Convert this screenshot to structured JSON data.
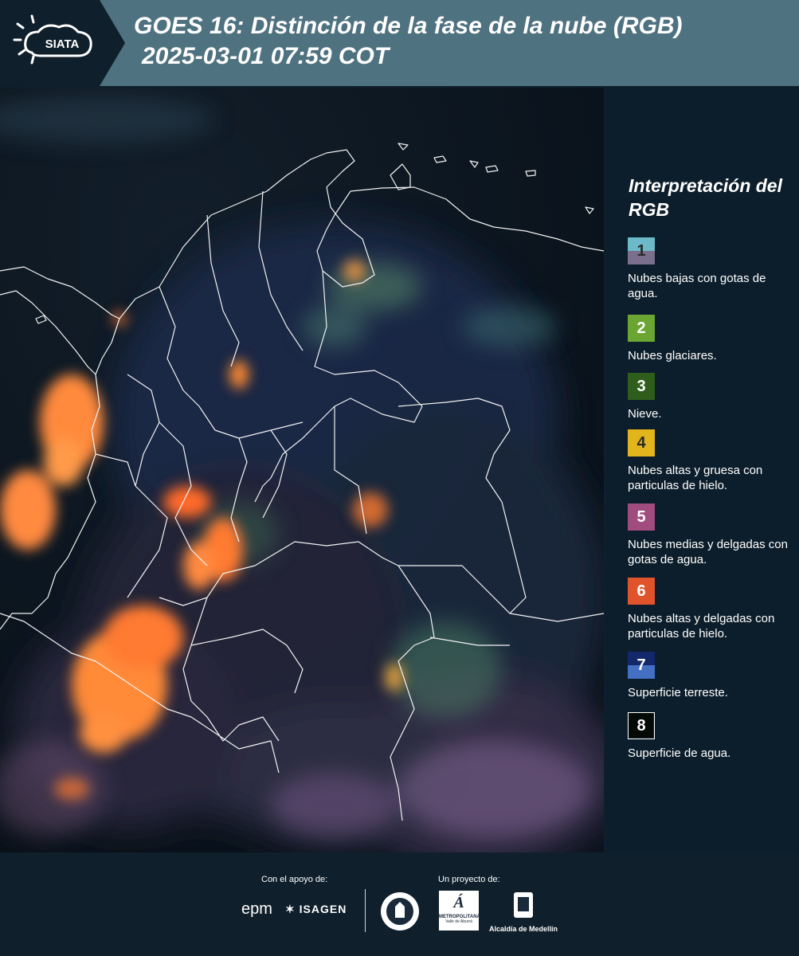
{
  "header": {
    "logo_text": "SIATA",
    "title_line1": "GOES 16: Distinción de la fase de la nube (RGB)",
    "title_line2": "2025-03-01 07:59 COT"
  },
  "legend": {
    "title": "Interpretación del RGB",
    "items": [
      {
        "number": "1",
        "label": "Nubes bajas con gotas de agua.",
        "color_top": "#6cbac8",
        "color_bottom": "#7a6f8c"
      },
      {
        "number": "2",
        "label": "Nubes glaciares.",
        "color_top": "#6aa631",
        "color_bottom": "#6aa631"
      },
      {
        "number": "3",
        "label": "Nieve.",
        "color_top": "#2f5e1c",
        "color_bottom": "#2f5e1c"
      },
      {
        "number": "4",
        "label": "Nubes altas y gruesa con particulas de hielo.",
        "color_top": "#e3b51c",
        "color_bottom": "#e3b51c"
      },
      {
        "number": "5",
        "label": "Nubes medias y delgadas con gotas de agua.",
        "color_top": "#a04c7e",
        "color_bottom": "#a04c7e"
      },
      {
        "number": "6",
        "label": "Nubes altas y delgadas con particulas de hielo.",
        "color_top": "#e0532b",
        "color_bottom": "#e0532b"
      },
      {
        "number": "7",
        "label": "Superficie terreste.",
        "color_top": "#13286a",
        "color_bottom": "#4470c4"
      },
      {
        "number": "8",
        "label": "Superficie de agua.",
        "color_top": "#050a06",
        "color_bottom": "#050a06"
      }
    ]
  },
  "footer": {
    "support_label": "Con el apoyo de:",
    "project_label": "Un proyecto de:",
    "epm": "epm",
    "isagen": "ISAGEN",
    "area_text": "METROPOLITANA",
    "area_sub": "Valle de Aburrá",
    "alcaldia": "Alcaldía de Medellín"
  }
}
